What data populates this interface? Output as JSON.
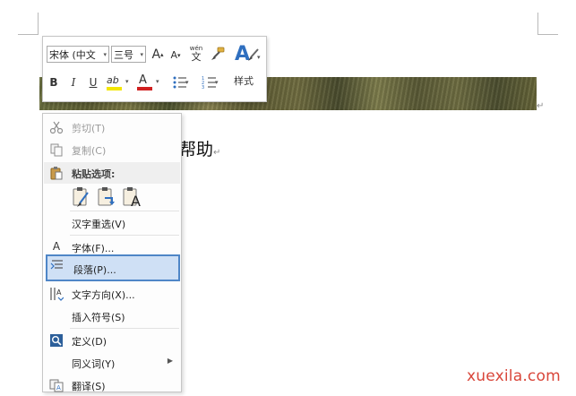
{
  "document": {
    "visible_text": "帮助",
    "paragraph_mark": "↵"
  },
  "mini_toolbar": {
    "font_name": "宋体 (中文",
    "font_size": "三号",
    "grow_font_label": "A",
    "shrink_font_label": "A",
    "phonetic_label": "wén",
    "phonetic_char": "文",
    "bold_label": "B",
    "italic_label": "I",
    "underline_label": "U",
    "highlight_label": "ab",
    "font_color_label": "A",
    "styles_label": "样式",
    "dropdown_glyph": "▾"
  },
  "context_menu": {
    "items": [
      {
        "label": "剪切(T)",
        "icon": "scissors-icon",
        "disabled": true
      },
      {
        "label": "复制(C)",
        "icon": "copy-icon",
        "disabled": true
      },
      {
        "label": "粘贴选项:",
        "icon": "clipboard-icon"
      },
      {
        "label": "汉字重选(V)"
      },
      {
        "label": "字体(F)...",
        "icon": "font-icon",
        "icon_text": "A"
      },
      {
        "label": "段落(P)...",
        "icon": "paragraph-icon",
        "highlighted": true
      },
      {
        "label": "文字方向(X)...",
        "icon": "text-direction-icon"
      },
      {
        "label": "插入符号(S)"
      },
      {
        "label": "定义(D)",
        "icon": "search-icon"
      },
      {
        "label": "同义词(Y)",
        "submenu_arrow": "▶"
      },
      {
        "label": "翻译(S)",
        "icon": "translate-icon"
      }
    ],
    "paste_options": [
      {
        "icon": "paste-keep-formatting-icon",
        "letter": ""
      },
      {
        "icon": "paste-merge-formatting-icon",
        "letter": ""
      },
      {
        "icon": "paste-text-only-icon",
        "letter": "A"
      }
    ]
  },
  "colors": {
    "highlight_bar": "#f3e600",
    "font_color_bar": "#d02020",
    "menu_hover_bg": "#cfe0f5",
    "menu_hover_border": "#4f86c7",
    "watermark": "#d9463a"
  },
  "watermark": {
    "text": "xuexila.com"
  }
}
